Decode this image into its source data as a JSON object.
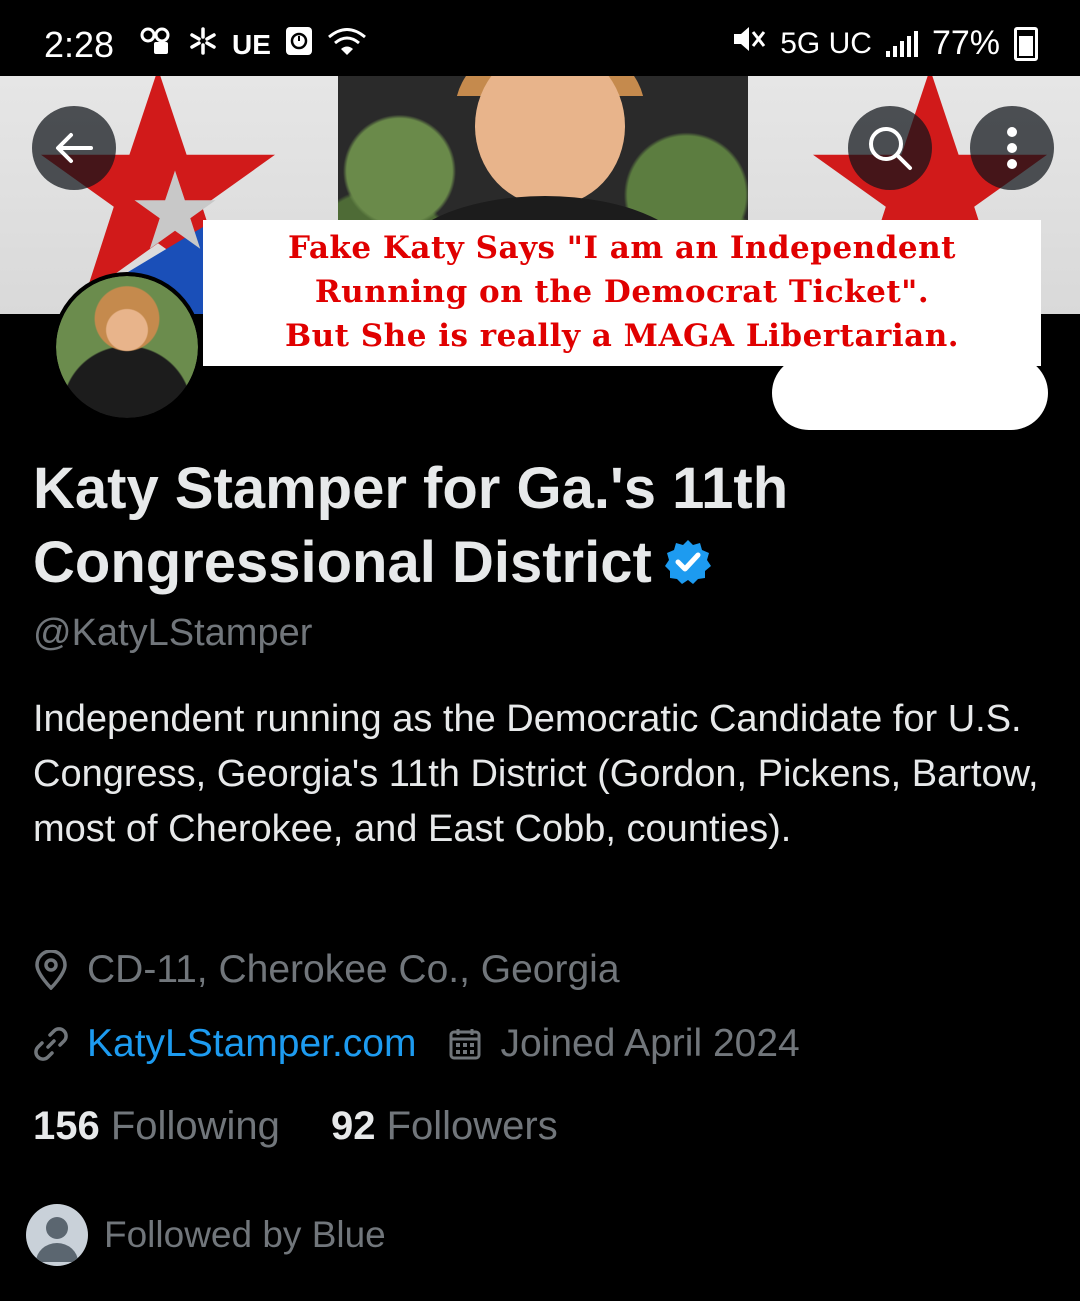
{
  "status_bar": {
    "time": "2:28",
    "left_icons": [
      "voicemail-icon",
      "walmart-spark-icon",
      "ue-label",
      "clock-app-icon",
      "wifi-icon"
    ],
    "ue_label": "UE",
    "network": "5G UC",
    "battery": "77%"
  },
  "banner": {
    "caption_lines": [
      "Fake Katy Says \"I am an Independent",
      "Running on the Democrat Ticket\".",
      "But She is really a MAGA Libertarian."
    ]
  },
  "profile": {
    "display_name": "Katy Stamper for Ga.'s 11th Congressional District",
    "verified": true,
    "handle": "@KatyLStamper",
    "bio": "Independent running as the Democratic Candidate for U.S. Congress, Georgia's 11th District (Gordon, Pickens, Bartow, most of Cherokee, and East Cobb, counties).",
    "location": "CD-11, Cherokee Co., Georgia",
    "website": "KatyLStamper.com",
    "joined": "Joined April 2024",
    "following_count": "156",
    "following_label": "Following",
    "followers_count": "92",
    "followers_label": "Followers",
    "followed_by": "Followed by Blue"
  },
  "colors": {
    "background": "#000000",
    "text": "#e7e9ea",
    "secondary": "#71767b",
    "link": "#1d9bf0",
    "caption_red": "#e00000"
  }
}
